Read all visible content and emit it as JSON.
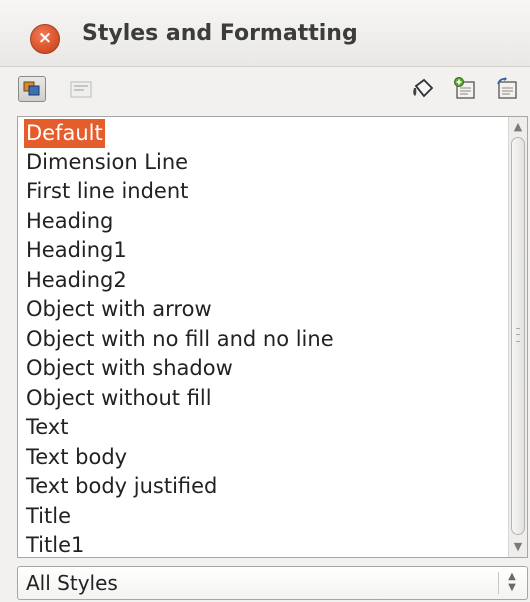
{
  "window": {
    "title": "Styles and Formatting",
    "close_glyph": "×"
  },
  "toolbar": {
    "buttons": [
      {
        "icon": "graphics-styles-icon",
        "state": "active"
      },
      {
        "icon": "presentation-styles-icon",
        "state": "disabled"
      },
      {
        "icon": "fill-format-mode-icon"
      },
      {
        "icon": "new-style-from-selection-icon"
      },
      {
        "icon": "update-style-icon"
      }
    ]
  },
  "styles_list": {
    "selected": "Default",
    "items": [
      "Default",
      "Dimension Line",
      "First line indent",
      "Heading",
      "Heading1",
      "Heading2",
      "Object with arrow",
      "Object with no fill and no line",
      "Object with shadow",
      "Object without fill",
      "Text",
      "Text body",
      "Text body justified",
      "Title",
      "Title1"
    ]
  },
  "filter": {
    "value": "All Styles"
  },
  "colors": {
    "selection": "#e65d2c",
    "close_button": "#d9532b"
  }
}
